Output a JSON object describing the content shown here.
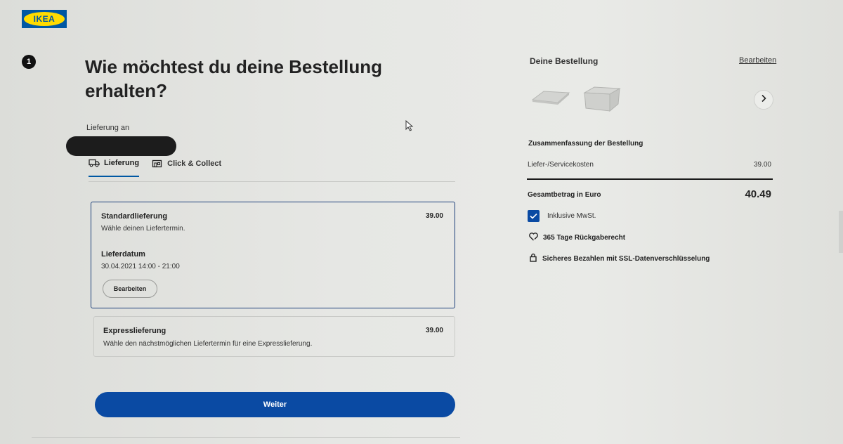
{
  "brand": {
    "logo_text": "IKEA",
    "blue": "#0058a3",
    "yellow": "#ffdb00"
  },
  "step": {
    "number": "1"
  },
  "heading": {
    "title": "Wie möchtest du deine Bestellung erhalten?"
  },
  "delivery_to": {
    "label": "Lieferung an"
  },
  "tabs": [
    {
      "label": "Lieferung",
      "icon": "truck-icon",
      "active": true
    },
    {
      "label": "Click & Collect",
      "icon": "store-icon",
      "active": false
    }
  ],
  "options": {
    "standard": {
      "title": "Standardlieferung",
      "subtitle": "Wähle deinen Liefertermin.",
      "price": "39.00",
      "date_label": "Lieferdatum",
      "date_value": "30.04.2021 14:00 - 21:00",
      "edit_label": "Bearbeiten"
    },
    "express": {
      "title": "Expresslieferung",
      "subtitle": "Wähle den nächstmöglichen Liefertermin für eine Expresslieferung.",
      "price": "39.00"
    }
  },
  "continue_button": {
    "label": "Weiter"
  },
  "order": {
    "title": "Deine Bestellung",
    "edit_link": "Bearbeiten",
    "products": [
      {
        "icon": "tray-lid-icon"
      },
      {
        "icon": "storage-box-icon"
      }
    ]
  },
  "summary": {
    "title": "Zusammenfassung der Bestellung",
    "fee_label": "Liefer-/Servicekosten",
    "fee_value": "39.00",
    "total_label": "Gesamtbetrag in Euro",
    "total_value": "40.49",
    "vat_label": "Inklusive MwSt.",
    "vat_checked": true,
    "perks": [
      {
        "icon": "heart-return-icon",
        "label": "365 Tage Rückgaberecht"
      },
      {
        "icon": "lock-icon",
        "label": "Sicheres Bezahlen mit SSL-Datenverschlüsselung"
      }
    ]
  },
  "colors": {
    "primary_button": "#0a4aa3",
    "selected_border": "#1d3f7a"
  }
}
